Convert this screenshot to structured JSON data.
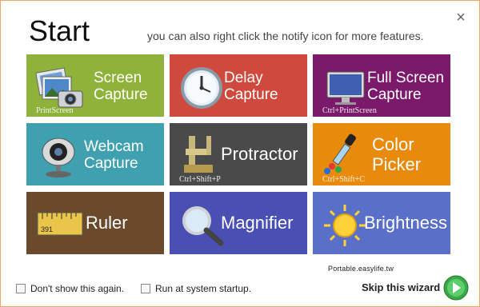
{
  "header": {
    "title": "Start",
    "subtitle": "you can also right click the notify icon for more features.",
    "close_label": "×"
  },
  "tiles": [
    {
      "label1": "Screen",
      "label2": "Capture",
      "hotkey": "PrintScreen",
      "color": "#8fb33a",
      "icon": "photos-camera-icon"
    },
    {
      "label1": "Delay",
      "label2": "Capture",
      "hotkey": "",
      "color": "#cf4a3c",
      "icon": "clock-icon"
    },
    {
      "label1": "Full Screen",
      "label2": "Capture",
      "hotkey": "Ctrl+PrintScreen",
      "color": "#7b1a6b",
      "icon": "monitor-icon"
    },
    {
      "label1": "Webcam",
      "label2": "Capture",
      "hotkey": "",
      "color": "#3fa0b0",
      "icon": "webcam-icon"
    },
    {
      "label1": "Protractor",
      "label2": "",
      "hotkey": "Ctrl+Shift+P",
      "color": "#4a4a4a",
      "icon": "caliper-icon"
    },
    {
      "label1": "Color",
      "label2": "Picker",
      "hotkey": "Ctrl+Shift+C",
      "color": "#e88a0c",
      "icon": "eyedropper-icon"
    },
    {
      "label1": "Ruler",
      "label2": "",
      "hotkey": "",
      "color": "#6b4a2c",
      "icon": "ruler-icon"
    },
    {
      "label1": "Magnifier",
      "label2": "",
      "hotkey": "",
      "color": "#4a4fb4",
      "icon": "magnifier-icon"
    },
    {
      "label1": "Brightness",
      "label2": "",
      "hotkey": "",
      "color": "#5a6fc8",
      "icon": "sun-icon"
    }
  ],
  "ruler_icon_text": "391",
  "footer": {
    "dont_show": "Don't show this again.",
    "run_startup": "Run at system startup.",
    "skip": "Skip this wizard",
    "watermark": "Portable.easylife.tw"
  }
}
